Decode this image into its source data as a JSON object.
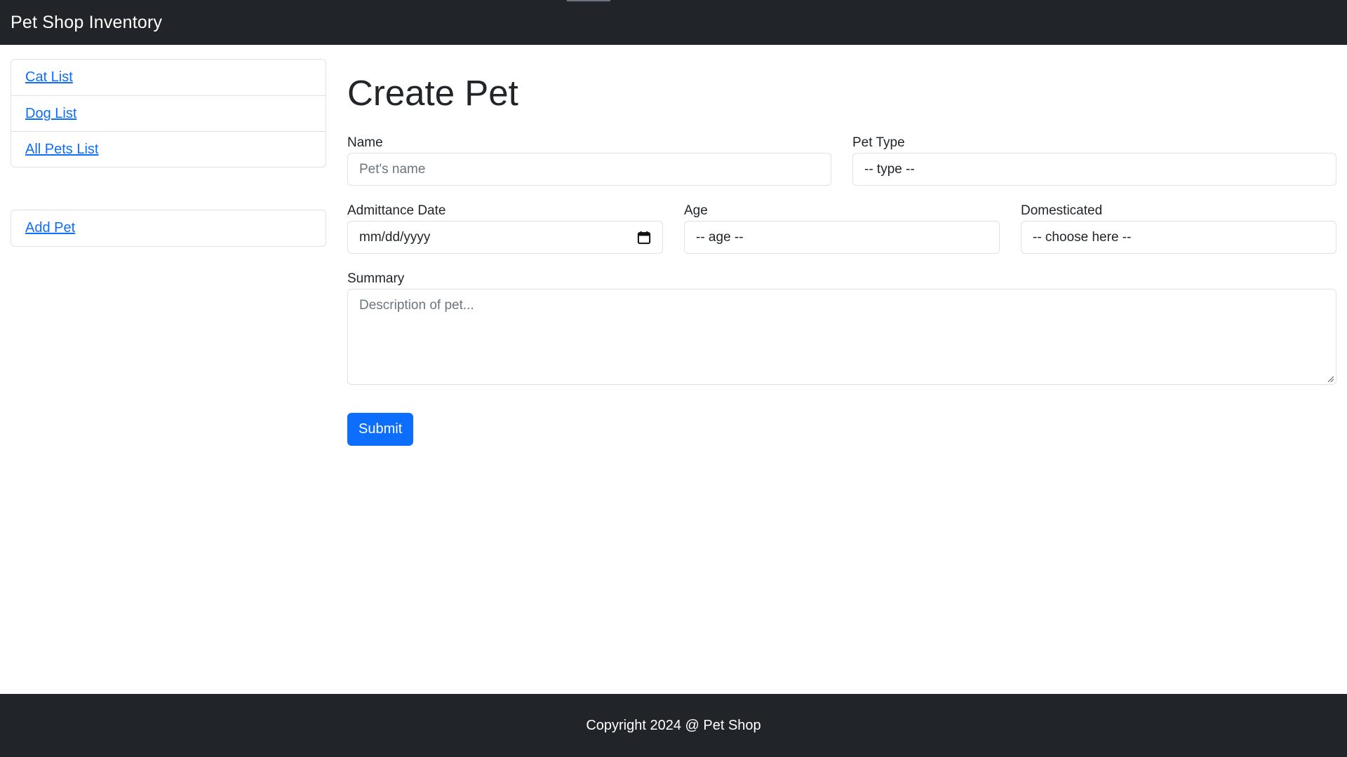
{
  "navbar": {
    "brand": "Pet Shop Inventory"
  },
  "sidebar": {
    "lists": [
      {
        "label": "Cat List"
      },
      {
        "label": "Dog List"
      },
      {
        "label": "All Pets List"
      }
    ],
    "actions": [
      {
        "label": "Add Pet"
      }
    ]
  },
  "form": {
    "title": "Create Pet",
    "name": {
      "label": "Name",
      "placeholder": "Pet's name",
      "value": ""
    },
    "pet_type": {
      "label": "Pet Type",
      "selected": "-- type --"
    },
    "admittance_date": {
      "label": "Admittance Date",
      "value": "mm/dd/yyyy",
      "icon": "calendar-icon"
    },
    "age": {
      "label": "Age",
      "selected": "-- age --"
    },
    "domesticated": {
      "label": "Domesticated",
      "selected": "-- choose here --"
    },
    "summary": {
      "label": "Summary",
      "placeholder": "Description of pet..."
    },
    "submit_label": "Submit"
  },
  "footer": {
    "text": "Copyright 2024 @ Pet Shop"
  },
  "colors": {
    "navbar_bg": "#212529",
    "link": "#0d6efd",
    "primary_button": "#0d6efd",
    "border": "#dee2e6"
  }
}
